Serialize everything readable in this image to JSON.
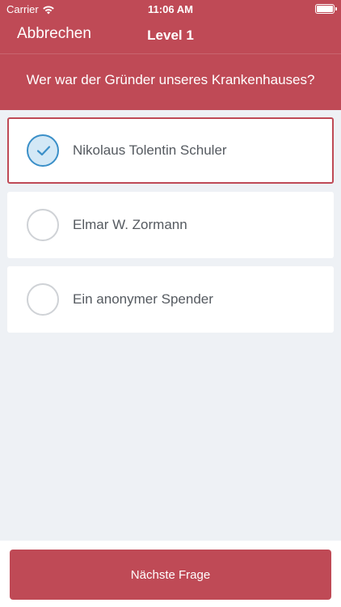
{
  "status_bar": {
    "carrier": "Carrier",
    "time": "11:06 AM",
    "icons": [
      "wifi-icon",
      "battery-icon"
    ]
  },
  "nav": {
    "cancel_label": "Abbrechen",
    "title": "Level 1"
  },
  "question": "Wer war der Gründer unseres Krankenhauses?",
  "answers": [
    {
      "label": "Nikolaus Tolentin Schuler",
      "selected": true
    },
    {
      "label": "Elmar W. Zormann",
      "selected": false
    },
    {
      "label": "Ein anonymer Spender",
      "selected": false
    }
  ],
  "footer": {
    "next_label": "Nächste Frage"
  },
  "colors": {
    "accent": "#bf4a56",
    "background": "#eef1f5",
    "selected_check": "#3a8fc8",
    "selected_fill": "#d3e8f6"
  }
}
